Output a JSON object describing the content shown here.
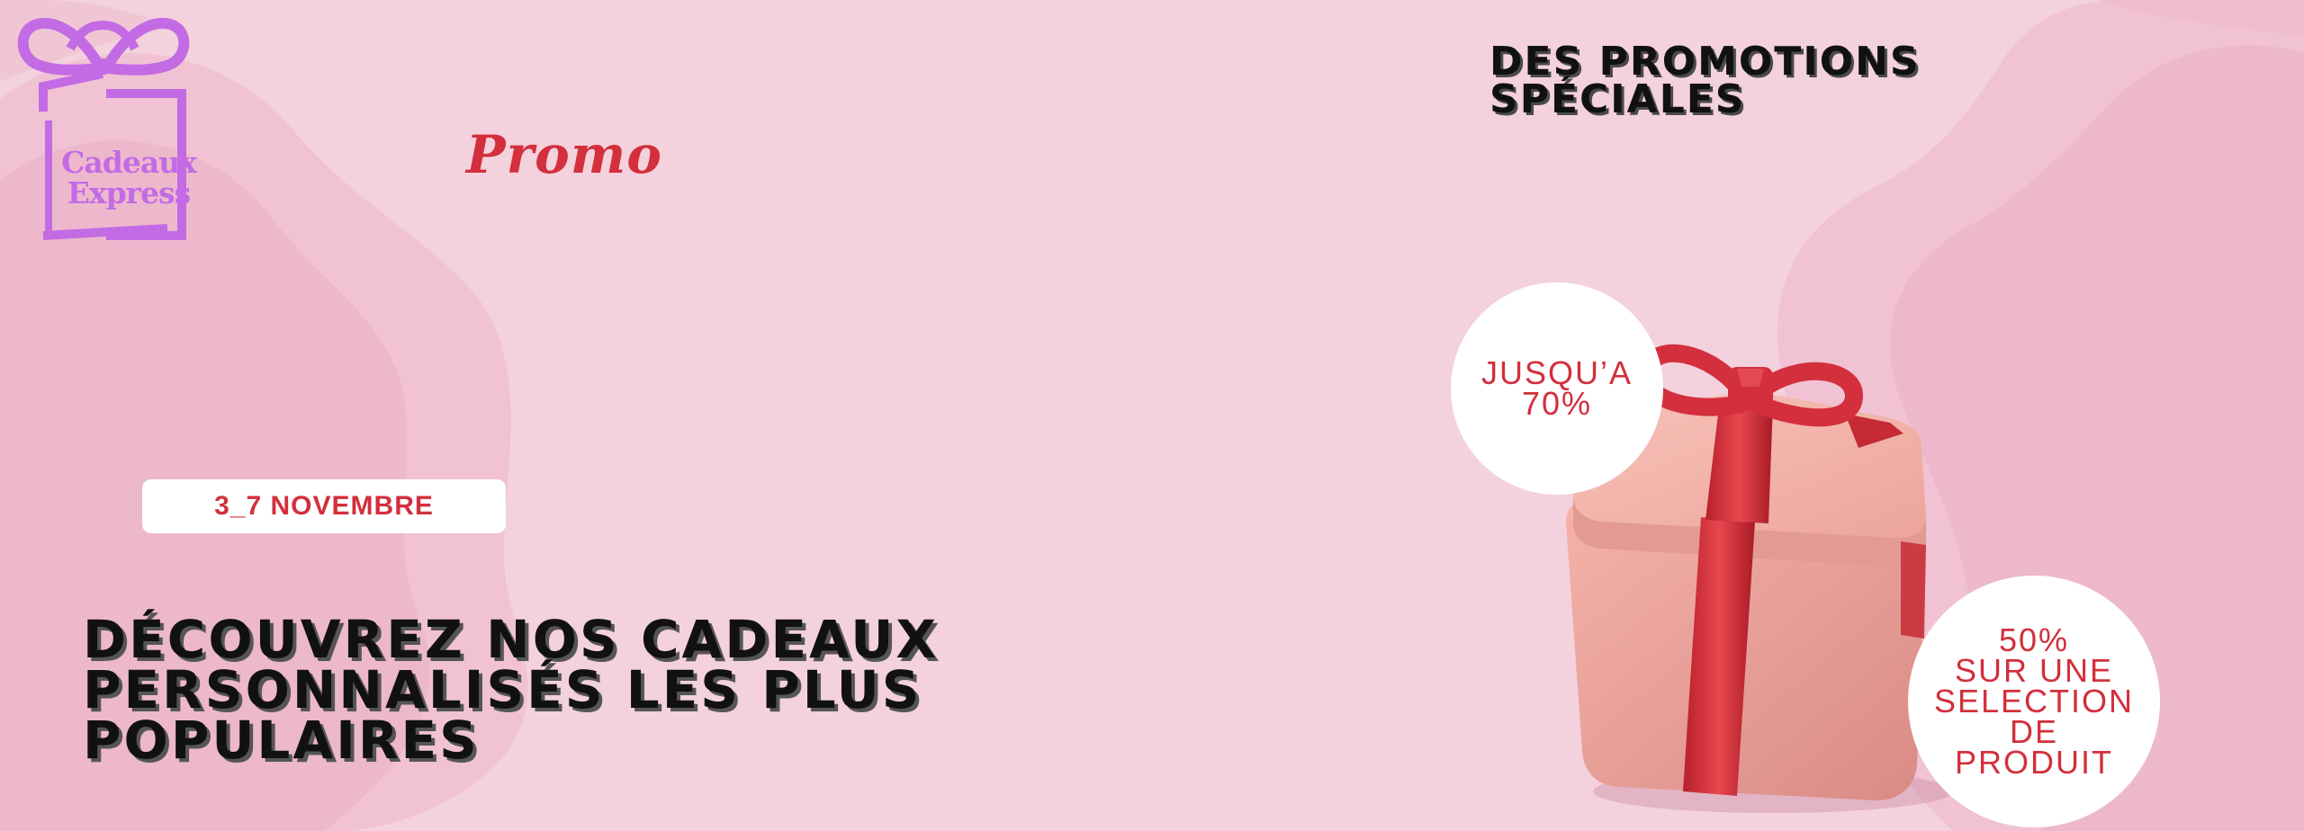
{
  "brand": {
    "name_line1": "Cadeaux",
    "name_line2": "Express",
    "logo_color": "#c36be5"
  },
  "promo_word": "Promo",
  "top_headline": {
    "line1": "DES PROMOTIONS",
    "line2": "SPÉCIALES"
  },
  "date_badge": "3_7 NOVEMBRE",
  "main_headline": {
    "line1": "DÉCOUVREZ NOS CADEAUX",
    "line2": "PERSONNALISÉS LES PLUS",
    "line3": "POPULAIRES"
  },
  "discount_badge_1": {
    "line1": "JUSQU’A",
    "line2": "70%"
  },
  "discount_badge_2": {
    "line1": "50%",
    "line2": "SUR UNE",
    "line3": "SELECTION",
    "line4": "DE",
    "line5": "PRODUIT"
  },
  "colors": {
    "background": "#f3d1dd",
    "blob": "#ecb6ca",
    "accent_red": "#d32f3c",
    "gift_box": "#eea79e",
    "headline": "#111111"
  },
  "icons": {
    "logo": "gift-box-outline-icon",
    "hero": "gift-box-illustration"
  }
}
